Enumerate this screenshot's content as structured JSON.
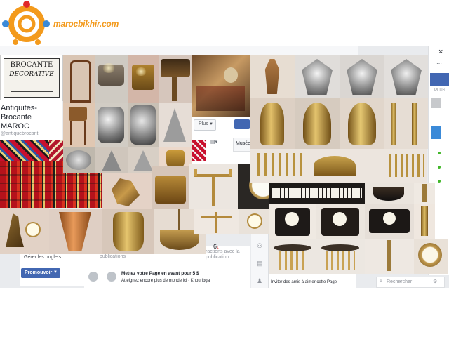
{
  "brand": {
    "name": "marocbikhir.com"
  },
  "page": {
    "title_line1": "Antiquites-",
    "title_line2": "Brocante",
    "title_line3": "MAROC",
    "handle": "@antiquebrocant",
    "logo_line1": "BROCANTE",
    "logo_line2": "DECORATIVE"
  },
  "fb": {
    "plus_label": "Plus",
    "musee_label": "Musée",
    "manage_tabs": "Gérer les onglets",
    "promote_button": "Promouvoir",
    "publications_label": "publications",
    "interactions_count": "6",
    "interactions_label": "ractions avec la publication",
    "promo_title": "Mettez votre Page en avant pour 5 $",
    "promo_sub": "Atteignez encore plus de monde ici · Khouribga",
    "invite_label": "Inviter des amis à aimer cette Page",
    "search_placeholder": "Rechercher",
    "plus_side": "PLUS",
    "close_glyph": "×"
  },
  "colors": {
    "brand_orange": "#f39a1c",
    "fb_blue": "#4267b2",
    "accent_red": "#e12828"
  }
}
